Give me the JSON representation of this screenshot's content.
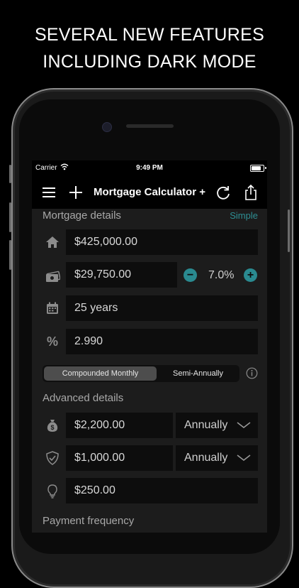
{
  "headline": {
    "line1": "SEVERAL NEW FEATURES",
    "line2": "INCLUDING DARK MODE"
  },
  "status_bar": {
    "carrier": "Carrier",
    "time": "9:49 PM"
  },
  "nav": {
    "title": "Mortgage Calculator +"
  },
  "mortgage_details": {
    "title": "Mortgage details",
    "mode_link": "Simple",
    "home_price": "$425,000.00",
    "down_payment": "$29,750.00",
    "down_payment_percent": "7.0%",
    "term": "25 years",
    "interest_rate": "2.990",
    "compounding": {
      "options": [
        "Compounded Monthly",
        "Semi-Annually"
      ],
      "selected": "Compounded Monthly"
    }
  },
  "advanced_details": {
    "title": "Advanced details",
    "property_tax": {
      "value": "$2,200.00",
      "period": "Annually"
    },
    "insurance": {
      "value": "$1,000.00",
      "period": "Annually"
    },
    "utilities": {
      "value": "$250.00"
    }
  },
  "payment_frequency": {
    "title": "Payment frequency"
  },
  "colors": {
    "accent": "#2a8a90",
    "background": "#1c1c1c",
    "field": "#0d0d0d"
  },
  "icons": [
    "menu-icon",
    "plus-icon",
    "refresh-icon",
    "share-icon",
    "home-icon",
    "cash-icon",
    "calendar-icon",
    "percent-icon",
    "info-icon",
    "money-bag-icon",
    "shield-icon",
    "lightbulb-icon",
    "chevron-down-icon",
    "wifi-icon",
    "battery-icon"
  ]
}
